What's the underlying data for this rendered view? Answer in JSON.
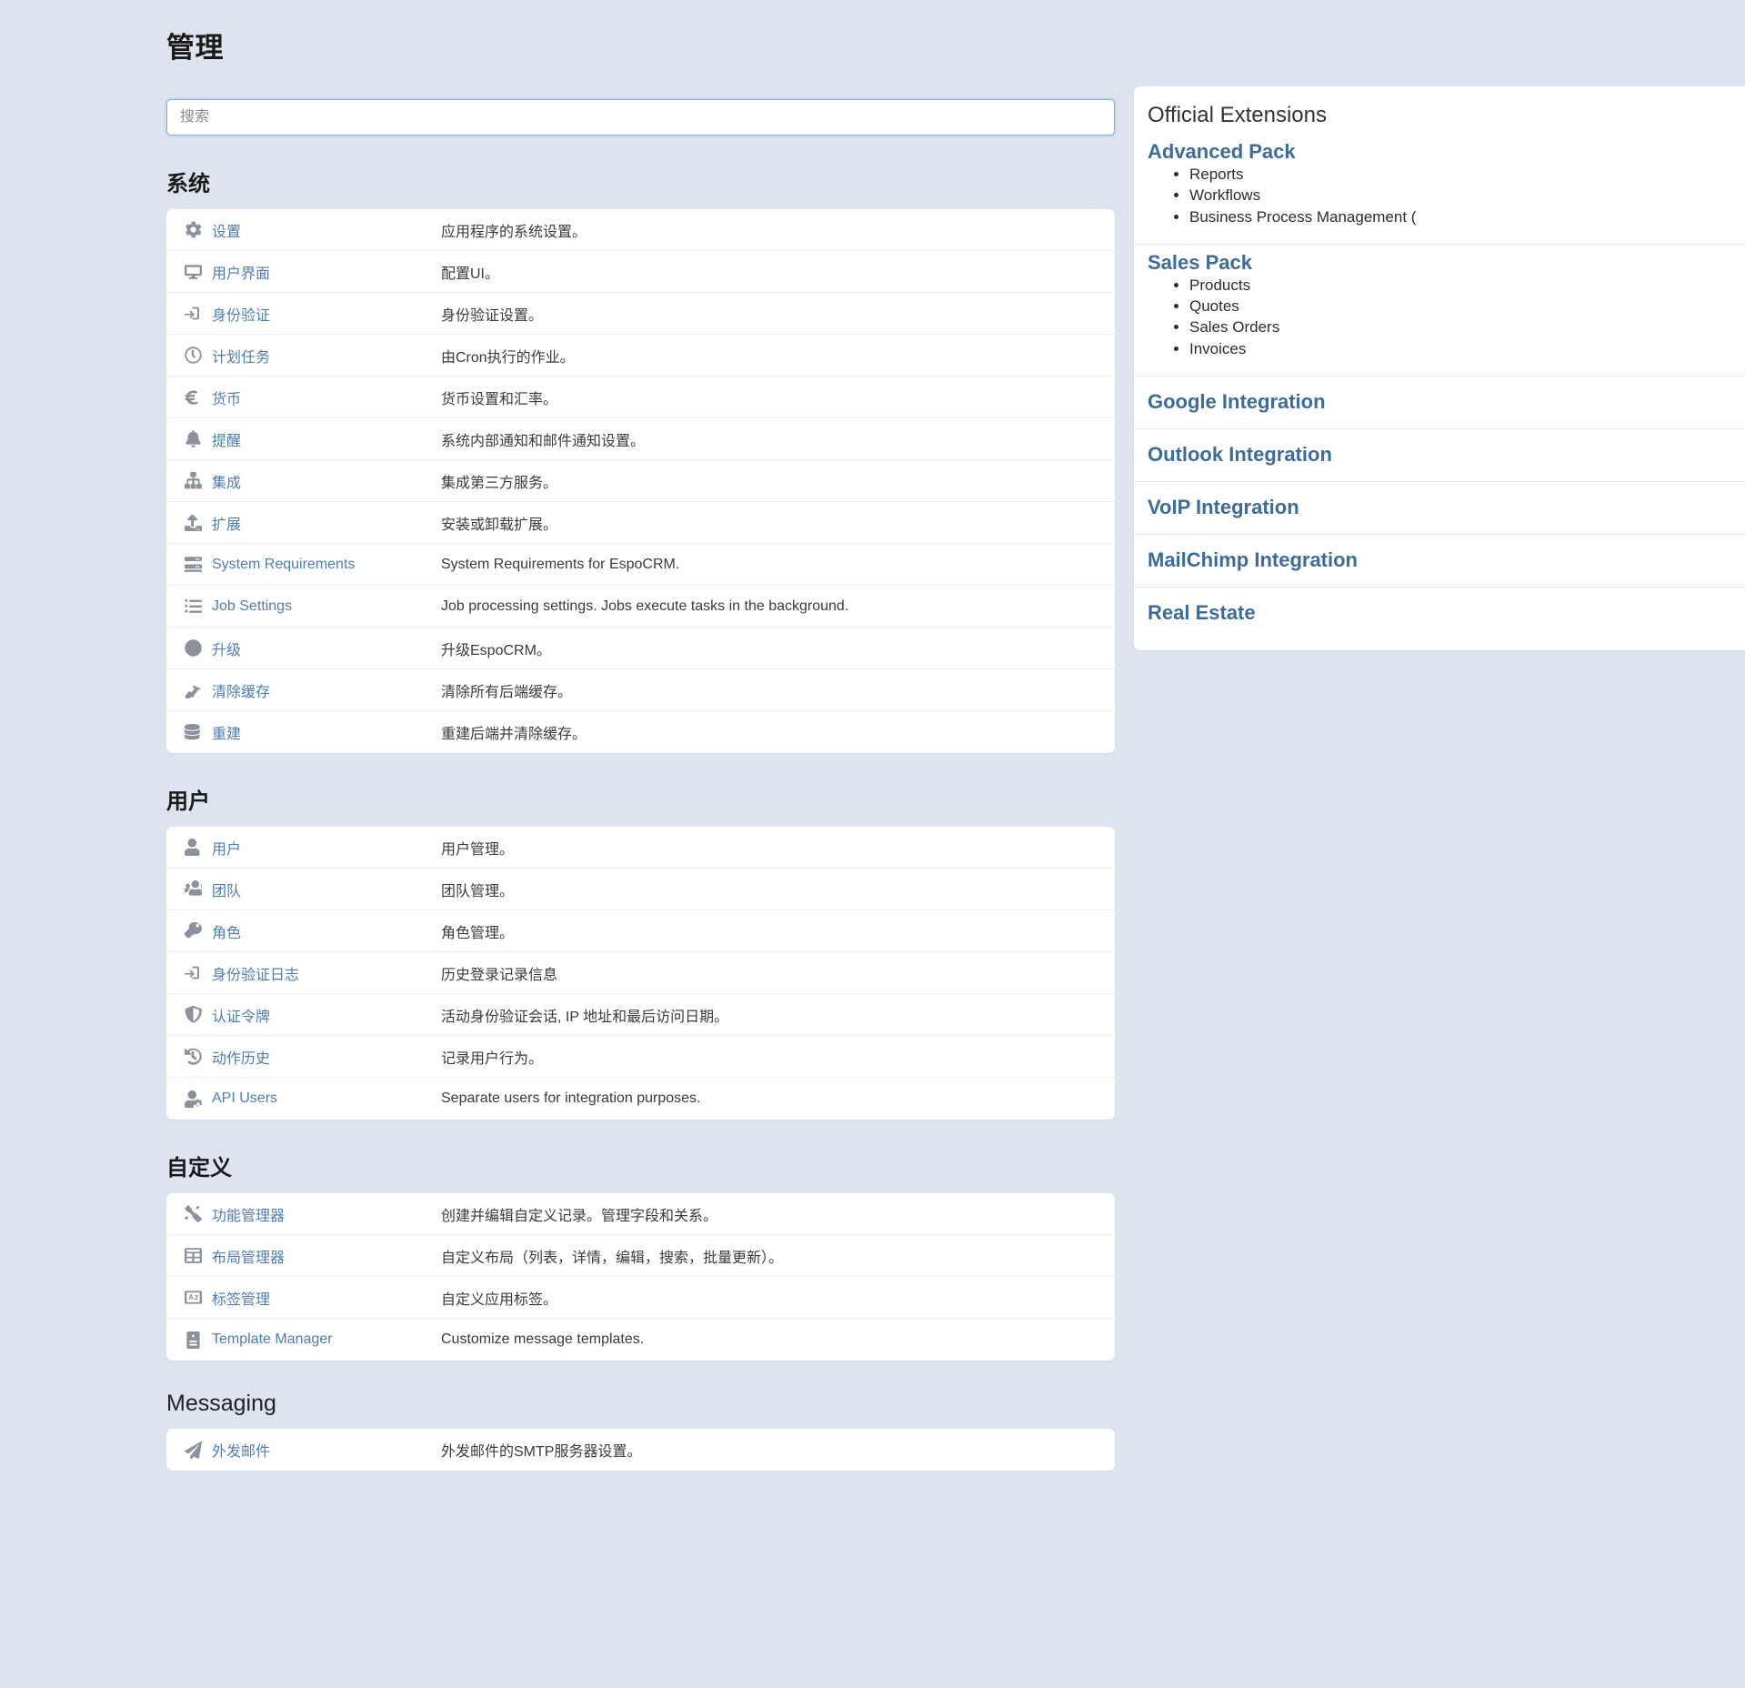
{
  "page": {
    "title": "管理"
  },
  "search": {
    "placeholder": "搜索",
    "value": ""
  },
  "sections": [
    {
      "id": "system",
      "title": "系统",
      "rows": [
        {
          "icon": "gear-icon",
          "label": "设置",
          "desc": "应用程序的系统设置。"
        },
        {
          "icon": "monitor-icon",
          "label": "用户界面",
          "desc": "配置UI。"
        },
        {
          "icon": "sign-in-icon",
          "label": "身份验证",
          "desc": "身份验证设置。"
        },
        {
          "icon": "clock-icon",
          "label": "计划任务",
          "desc": "由Cron执行的作业。"
        },
        {
          "icon": "euro-icon",
          "label": "货币",
          "desc": "货币设置和汇率。"
        },
        {
          "icon": "bell-icon",
          "label": "提醒",
          "desc": "系统内部通知和邮件通知设置。"
        },
        {
          "icon": "sitemap-icon",
          "label": "集成",
          "desc": "集成第三方服务。"
        },
        {
          "icon": "upload-icon",
          "label": "扩展",
          "desc": "安装或卸载扩展。"
        },
        {
          "icon": "server-icon",
          "label": "System Requirements",
          "desc": "System Requirements for EspoCRM."
        },
        {
          "icon": "list-icon",
          "label": "Job Settings",
          "desc": "Job processing settings. Jobs execute tasks in the background."
        },
        {
          "icon": "arrow-up-circle-icon",
          "label": "升级",
          "desc": "升级EspoCRM。"
        },
        {
          "icon": "broom-icon",
          "label": "清除缓存",
          "desc": "清除所有后端缓存。"
        },
        {
          "icon": "database-icon",
          "label": "重建",
          "desc": "重建后端并清除缓存。"
        }
      ]
    },
    {
      "id": "users",
      "title": "用户",
      "rows": [
        {
          "icon": "user-icon",
          "label": "用户",
          "desc": "用户管理。"
        },
        {
          "icon": "users-icon",
          "label": "团队",
          "desc": "团队管理。"
        },
        {
          "icon": "key-icon",
          "label": "角色",
          "desc": "角色管理。"
        },
        {
          "icon": "sign-in-icon",
          "label": "身份验证日志",
          "desc": "历史登录记录信息"
        },
        {
          "icon": "shield-icon",
          "label": "认证令牌",
          "desc": "活动身份验证会话, IP 地址和最后访问日期。"
        },
        {
          "icon": "history-icon",
          "label": "动作历史",
          "desc": "记录用户行为。"
        },
        {
          "icon": "user-gear-icon",
          "label": "API Users",
          "desc": "Separate users for integration purposes."
        }
      ]
    },
    {
      "id": "customization",
      "title": "自定义",
      "rows": [
        {
          "icon": "tools-icon",
          "label": "功能管理器",
          "desc": "创建并编辑自定义记录。管理字段和关系。"
        },
        {
          "icon": "table-icon",
          "label": "布局管理器",
          "desc": "自定义布局（列表，详情，编辑，搜索，批量更新）。"
        },
        {
          "icon": "language-icon",
          "label": "标签管理",
          "desc": "自定义应用标签。"
        },
        {
          "icon": "template-icon",
          "label": "Template Manager",
          "desc": "Customize message templates."
        }
      ]
    },
    {
      "id": "messaging",
      "title": "Messaging",
      "title_en": true,
      "rows": [
        {
          "icon": "paper-plane-icon",
          "label": "外发邮件",
          "desc": "外发邮件的SMTP服务器设置。"
        }
      ]
    }
  ],
  "extensions": {
    "header": "Official Extensions",
    "blocks": [
      {
        "title": "Advanced Pack",
        "items": [
          "Reports",
          "Workflows",
          "Business Process Management ("
        ]
      },
      {
        "title": "Sales Pack",
        "items": [
          "Products",
          "Quotes",
          "Sales Orders",
          "Invoices"
        ]
      }
    ],
    "links": [
      "Google Integration",
      "Outlook Integration",
      "VoIP Integration",
      "MailChimp Integration",
      "Real Estate"
    ]
  },
  "colors": {
    "background": "#dde3ef",
    "link": "#4f7db3",
    "panel": "#ffffff",
    "icon": "#8c929c",
    "ext_link": "#3c6c99"
  }
}
